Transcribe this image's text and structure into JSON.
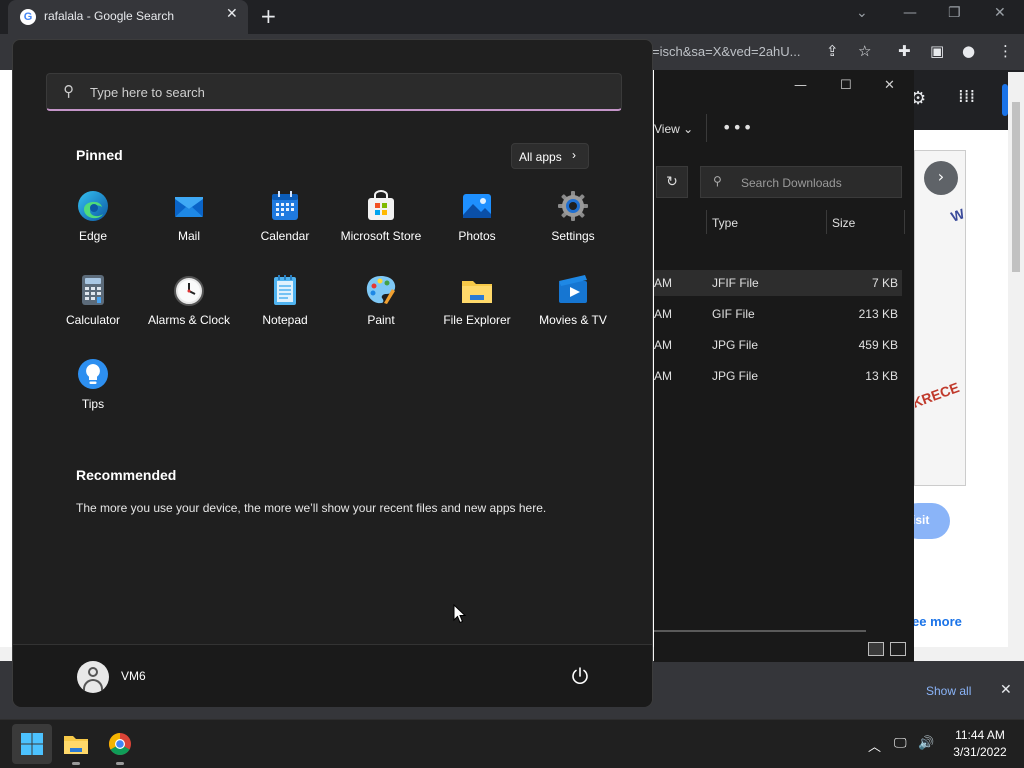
{
  "chrome": {
    "tab_title": "rafalala - Google Search",
    "favicon_letter": "G",
    "url_fragment": "=isch&sa=X&ved=2ahU...",
    "page_visit_label": "isit",
    "page_see_more": "ee more",
    "image_overlay_text_1": "W",
    "image_overlay_text_2": "KRECE",
    "download_shelf": {
      "show_all": "Show all"
    }
  },
  "explorer": {
    "view_label": "View",
    "search_placeholder": "Search Downloads",
    "columns": {
      "type": "Type",
      "size": "Size"
    },
    "files": [
      {
        "time": "AM",
        "type": "JFIF File",
        "size": "7 KB",
        "selected": true
      },
      {
        "time": "AM",
        "type": "GIF File",
        "size": "213 KB",
        "selected": false
      },
      {
        "time": "AM",
        "type": "JPG File",
        "size": "459 KB",
        "selected": false
      },
      {
        "time": "AM",
        "type": "JPG File",
        "size": "13 KB",
        "selected": false
      }
    ]
  },
  "start_menu": {
    "search_placeholder": "Type here to search",
    "pinned_label": "Pinned",
    "all_apps_label": "All apps",
    "pinned_apps": [
      {
        "label": "Edge",
        "icon": "edge-icon"
      },
      {
        "label": "Mail",
        "icon": "mail-icon"
      },
      {
        "label": "Calendar",
        "icon": "calendar-icon"
      },
      {
        "label": "Microsoft Store",
        "icon": "store-icon"
      },
      {
        "label": "Photos",
        "icon": "photos-icon"
      },
      {
        "label": "Settings",
        "icon": "gear-icon"
      },
      {
        "label": "Calculator",
        "icon": "calculator-icon"
      },
      {
        "label": "Alarms & Clock",
        "icon": "clock-icon"
      },
      {
        "label": "Notepad",
        "icon": "notepad-icon"
      },
      {
        "label": "Paint",
        "icon": "paint-icon"
      },
      {
        "label": "File Explorer",
        "icon": "folder-icon"
      },
      {
        "label": "Movies & TV",
        "icon": "movies-icon"
      },
      {
        "label": "Tips",
        "icon": "tips-icon"
      }
    ],
    "recommended_label": "Recommended",
    "recommended_text": "The more you use your device, the more we’ll show your recent files and new apps here.",
    "user_name": "VM6"
  },
  "taskbar": {
    "time": "11:44 AM",
    "date": "3/31/2022"
  },
  "colors": {
    "accent": "#0078d4",
    "search_underline": "#c495c8",
    "chrome_link": "#8ab4f8"
  }
}
